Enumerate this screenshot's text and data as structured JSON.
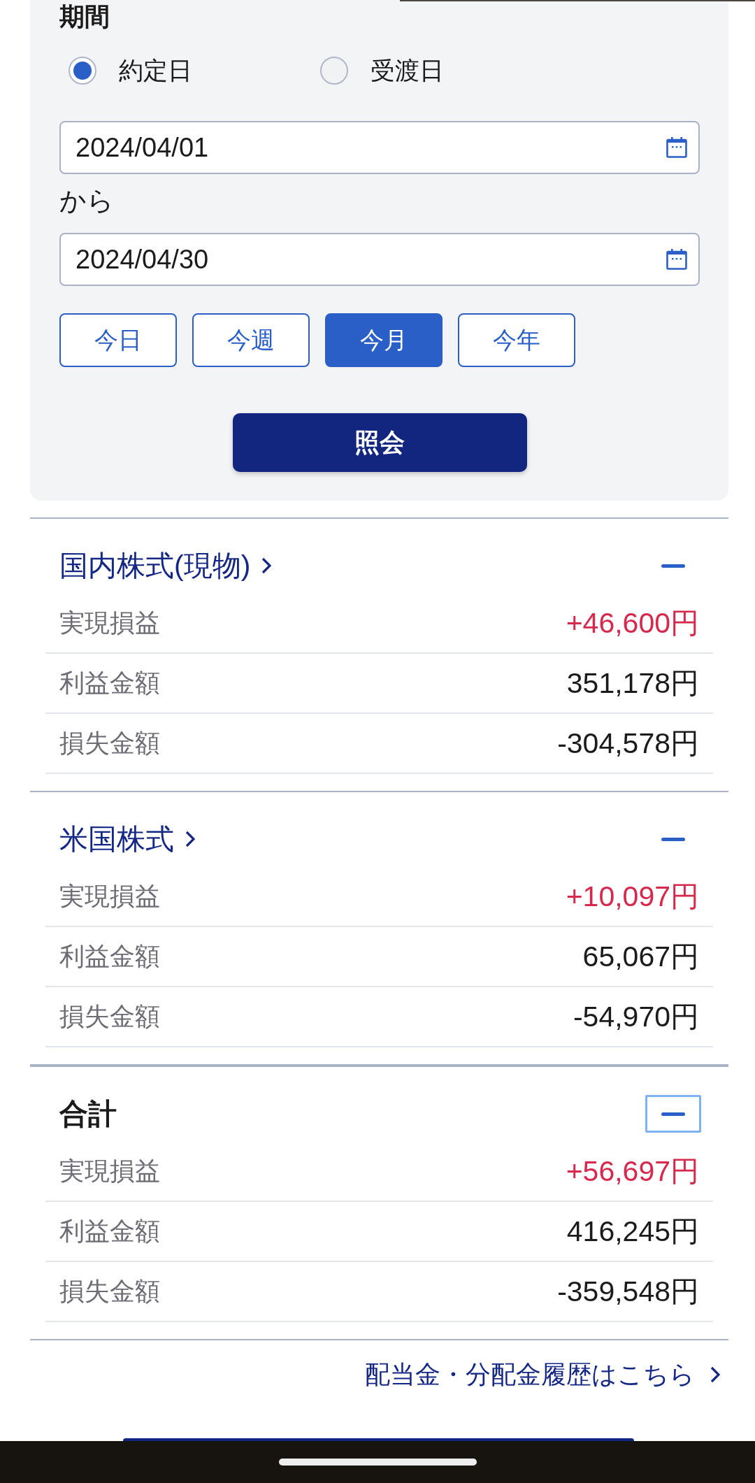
{
  "period": {
    "title": "期間",
    "date_types": [
      {
        "label": "約定日",
        "selected": true
      },
      {
        "label": "受渡日",
        "selected": false
      }
    ],
    "start_date": {
      "value": "2024/04/01"
    },
    "range_word": "から",
    "end_date": {
      "value": "2024/04/30"
    },
    "presets": [
      {
        "label": "今日",
        "selected": false
      },
      {
        "label": "今週",
        "selected": false
      },
      {
        "label": "今月",
        "selected": true
      },
      {
        "label": "今年",
        "selected": false
      }
    ],
    "search_button": "照会"
  },
  "sections": [
    {
      "kind": "category",
      "title": "国内株式(現物)",
      "expanded": true,
      "focused": false,
      "rows": [
        {
          "kind": "realized",
          "label": "実現損益",
          "value": "+46,600円"
        },
        {
          "kind": "amount",
          "label": "利益金額",
          "value": "351,178円"
        },
        {
          "kind": "amount",
          "label": "損失金額",
          "value": "-304,578円"
        }
      ]
    },
    {
      "kind": "category",
      "title": "米国株式",
      "expanded": true,
      "focused": false,
      "rows": [
        {
          "kind": "realized",
          "label": "実現損益",
          "value": "+10,097円"
        },
        {
          "kind": "amount",
          "label": "利益金額",
          "value": "65,067円"
        },
        {
          "kind": "amount",
          "label": "損失金額",
          "value": "-54,970円"
        }
      ]
    },
    {
      "kind": "total",
      "title": "合計",
      "expanded": true,
      "focused": true,
      "rows": [
        {
          "kind": "realized",
          "label": "実現損益",
          "value": "+56,697円"
        },
        {
          "kind": "amount",
          "label": "利益金額",
          "value": "416,245円"
        },
        {
          "kind": "amount",
          "label": "損失金額",
          "value": "-359,548円"
        }
      ]
    }
  ],
  "footer_link": "配当金・分配金履歴はこちら"
}
